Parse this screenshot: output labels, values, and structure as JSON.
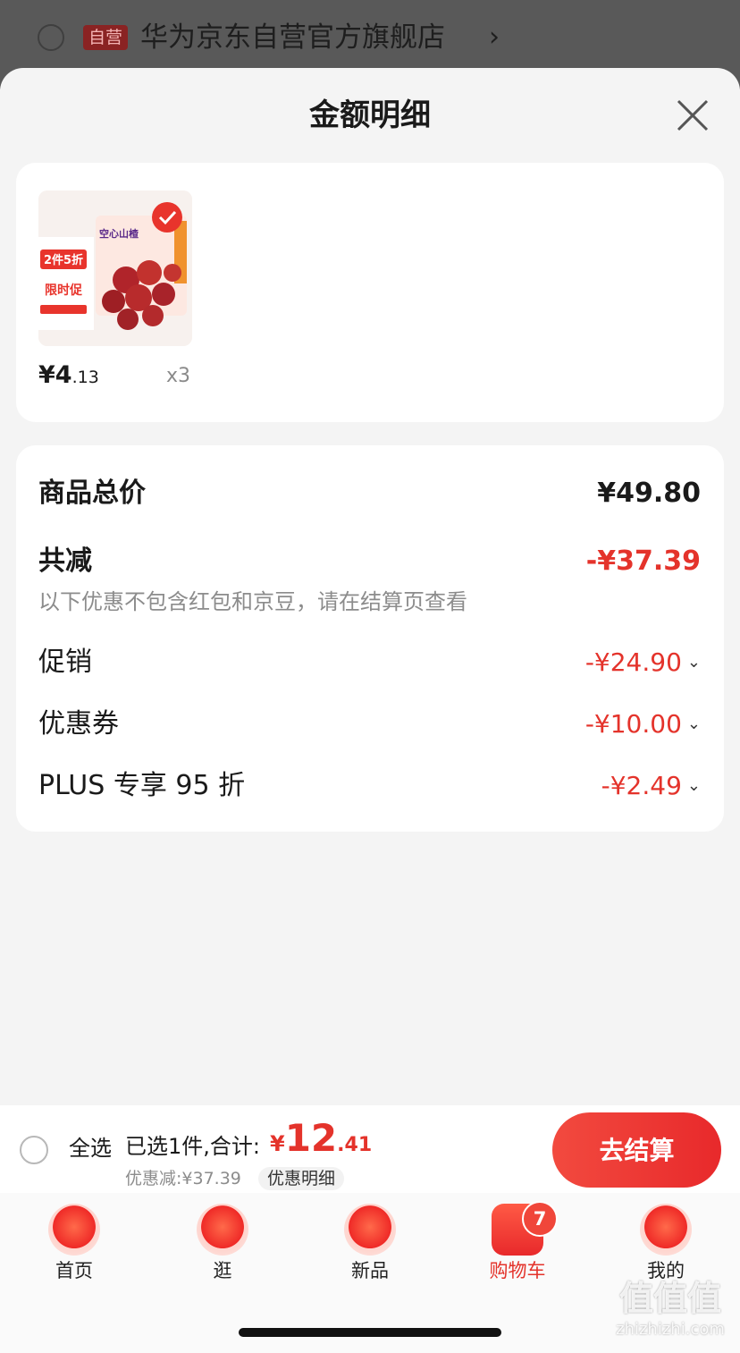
{
  "store": {
    "tag": "自营",
    "name": "华为京东自营官方旗舰店",
    "chevron": "›"
  },
  "sheet": {
    "title": "金额明细"
  },
  "product": {
    "price_int": "¥4",
    "price_dec": ".13",
    "quantity": "x3",
    "image_texts": {
      "promo1": "2件5折",
      "promo2": "限时促",
      "name": "空心山楂"
    }
  },
  "summary": {
    "total_label": "商品总价",
    "total_value": "¥49.80",
    "reduce_label": "共减",
    "reduce_value": "-¥37.39",
    "note": "以下优惠不包含红包和京豆，请在结算页查看",
    "rows": [
      {
        "label": "促销",
        "value": "-¥24.90"
      },
      {
        "label": "优惠券",
        "value": "-¥10.00"
      },
      {
        "label": "PLUS 专享 95 折",
        "value": "-¥2.49"
      }
    ]
  },
  "checkout": {
    "select_all": "全选",
    "selected": "已选1件,合计:",
    "total_cur": "¥",
    "total_int": "12",
    "total_dec": ".41",
    "discount": "优惠减:¥37.39",
    "detail": "优惠明细",
    "button": "去结算"
  },
  "tabs": [
    {
      "label": "首页",
      "icon": "home-icon"
    },
    {
      "label": "逛",
      "icon": "browse-icon"
    },
    {
      "label": "新品",
      "icon": "new-products-icon"
    },
    {
      "label": "购物车",
      "icon": "cart-icon",
      "active": true,
      "badge": "7"
    },
    {
      "label": "我的",
      "icon": "profile-icon"
    }
  ],
  "watermark": {
    "main": "值值值",
    "sub": "zhizhizhi.com"
  },
  "colors": {
    "accent": "#e4332b"
  }
}
